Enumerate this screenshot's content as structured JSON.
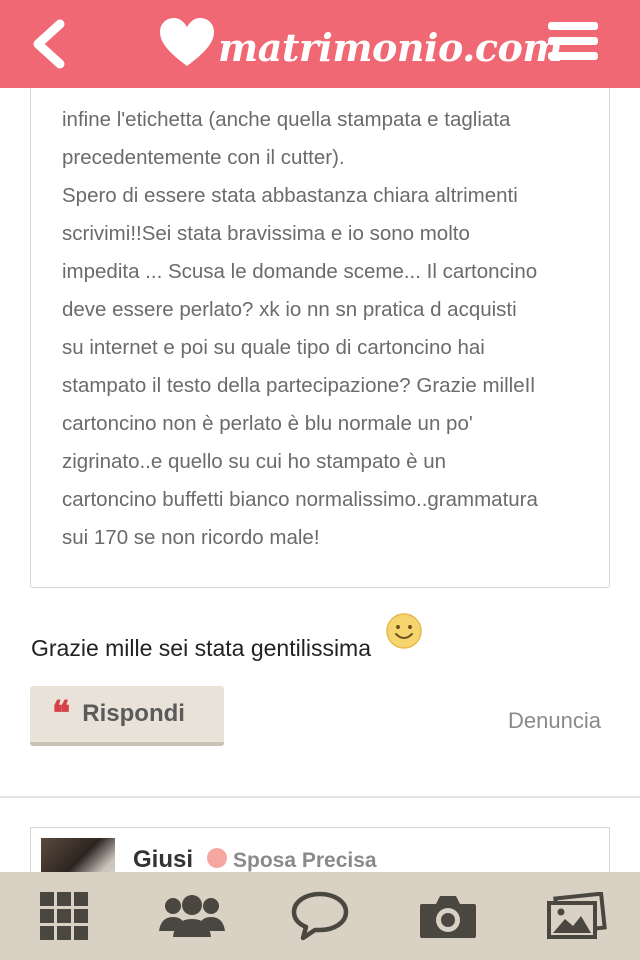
{
  "header": {
    "logo_text": "matrimonio.com",
    "brand_color": "#f06873",
    "icons": {
      "back": "chevron-left-icon",
      "logo": "heart-icon",
      "menu": "hamburger-menu-icon"
    }
  },
  "quoted_post": {
    "lines": [
      "infine l'etichetta (anche quella stampata e tagliata",
      "precedentemente con il cutter).",
      "Spero di essere stata abbastanza chiara altrimenti",
      "scrivimi!!Sei stata bravissima e io sono molto",
      "impedita ... Scusa le domande sceme... Il cartoncino",
      "deve essere perlato? xk io nn sn pratica d acquisti",
      "su internet e poi su quale tipo di cartoncino hai",
      "stampato il testo della partecipazione? Grazie milleIl",
      "cartoncino non è perlato è blu normale un po'",
      "zigrinato..e quello su cui ho stampato è un",
      "cartoncino buffetti bianco normalissimo..grammatura",
      "sui 170 se non ricordo male!"
    ]
  },
  "reply": {
    "message": "Grazie mille sei stata gentilissima",
    "emoji": "smiley-icon"
  },
  "actions": {
    "rispondi_label": "Rispondi",
    "quote_icon_glyph": "❝",
    "denuncia_label": "Denuncia"
  },
  "next_post": {
    "author": "Giusi",
    "role": "Sposa Precisa",
    "status_color": "#f6a6a0"
  },
  "bottom_nav": {
    "items": [
      "grid-icon",
      "community-icon",
      "chat-bubble-icon",
      "camera-icon",
      "photos-icon"
    ]
  }
}
